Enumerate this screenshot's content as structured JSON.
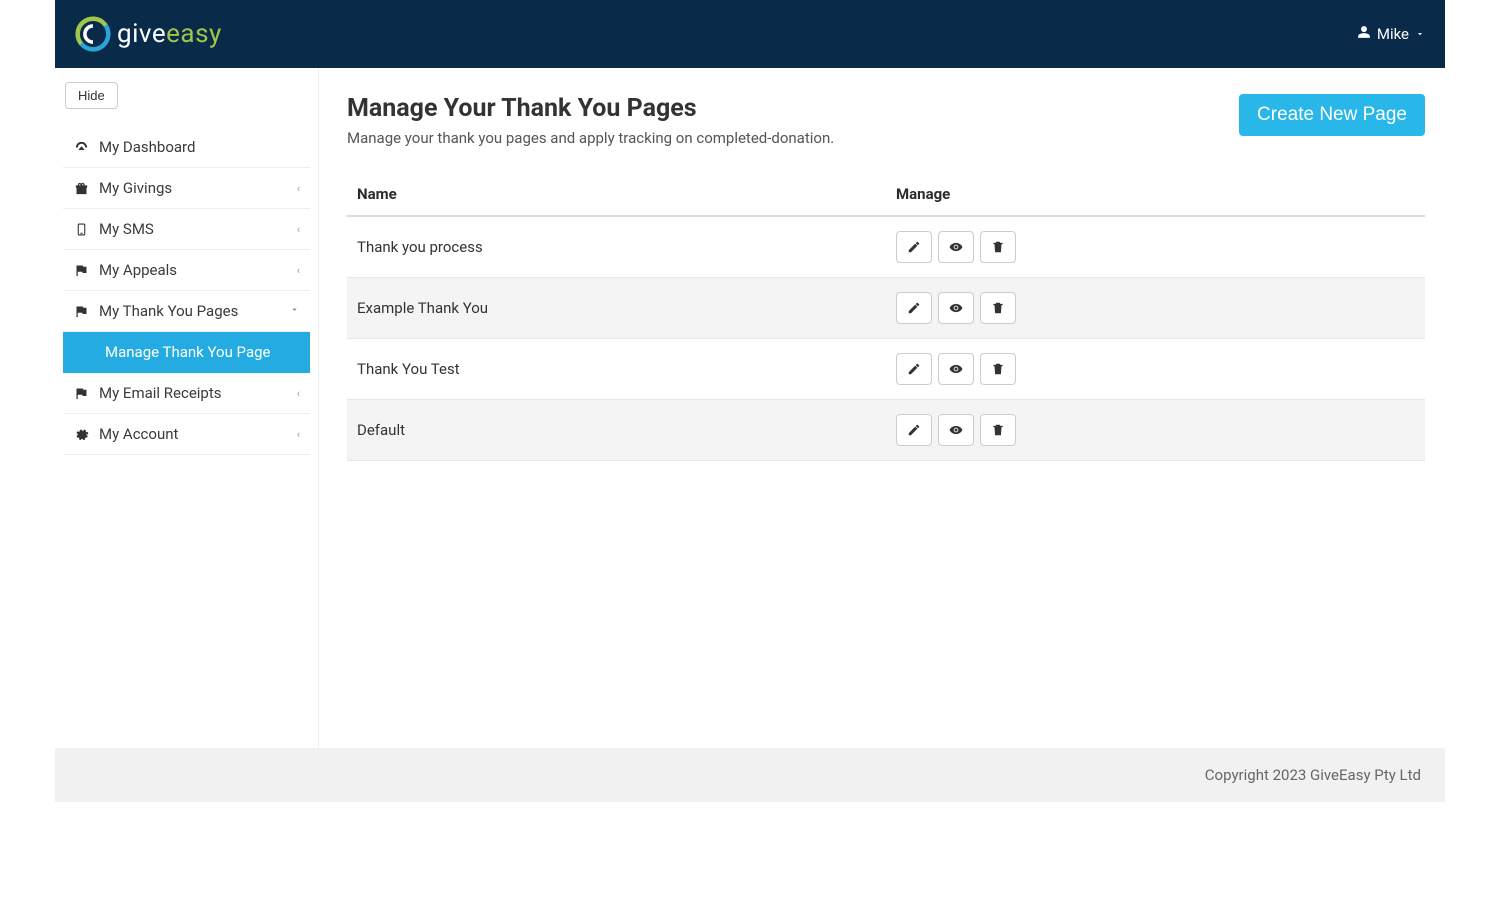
{
  "header": {
    "brand_give": "give",
    "brand_easy": "easy",
    "user_name": "Mike"
  },
  "sidebar": {
    "hide_label": "Hide",
    "items": [
      {
        "label": "My Dashboard",
        "icon": "dashboard",
        "chevron": false
      },
      {
        "label": "My Givings",
        "icon": "gift",
        "chevron": true
      },
      {
        "label": "My SMS",
        "icon": "mobile",
        "chevron": true
      },
      {
        "label": "My Appeals",
        "icon": "flag",
        "chevron": true
      },
      {
        "label": "My Thank You Pages",
        "icon": "flag",
        "chevron": true,
        "expanded": true,
        "sub": [
          {
            "label": "Manage Thank You Page",
            "active": true
          }
        ]
      },
      {
        "label": "My Email Receipts",
        "icon": "flag",
        "chevron": true
      },
      {
        "label": "My Account",
        "icon": "gear",
        "chevron": true
      }
    ]
  },
  "main": {
    "title": "Manage Your Thank You Pages",
    "subtitle": "Manage your thank you pages and apply tracking on completed-donation.",
    "create_label": "Create New Page",
    "columns": {
      "name": "Name",
      "manage": "Manage"
    },
    "rows": [
      {
        "name": "Thank you process"
      },
      {
        "name": "Example Thank You"
      },
      {
        "name": "Thank You Test"
      },
      {
        "name": "Default"
      }
    ]
  },
  "footer": {
    "copyright": "Copyright 2023 GiveEasy Pty Ltd"
  }
}
